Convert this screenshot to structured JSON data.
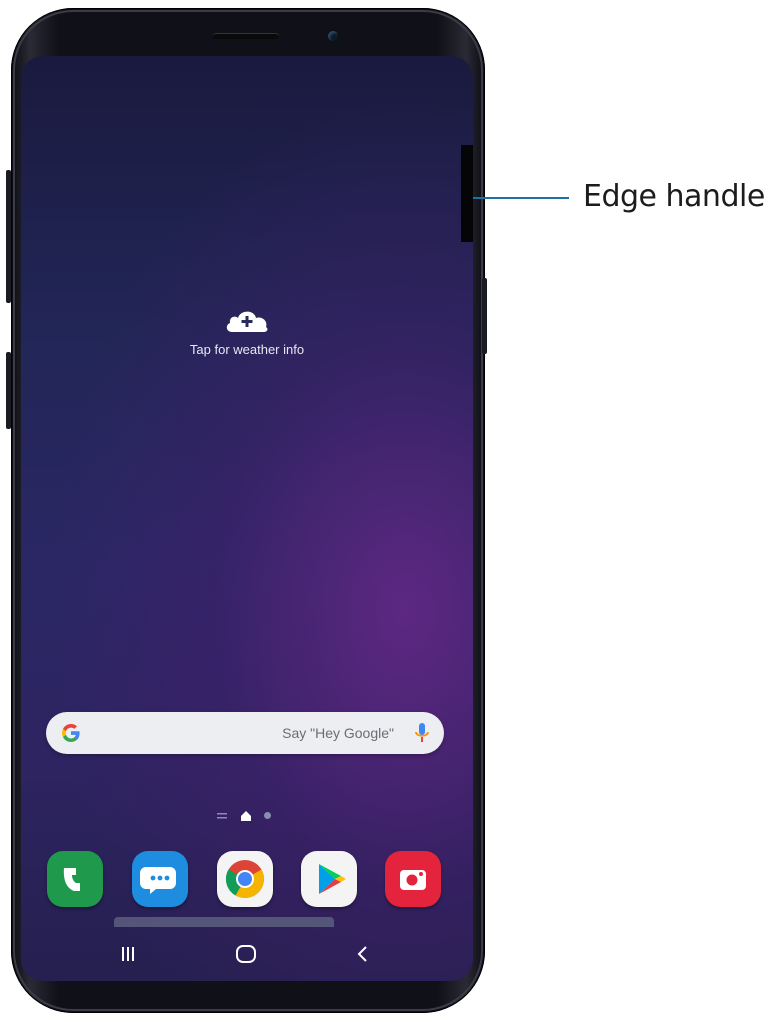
{
  "weather": {
    "label": "Tap for weather info",
    "icon": "cloud-plus-icon"
  },
  "search_bar": {
    "placeholder": "Say \"Hey Google\"",
    "logo": "google-g-icon",
    "mic": "microphone-icon"
  },
  "pager": {
    "pages": [
      "list",
      "home",
      "dot"
    ],
    "active": "home"
  },
  "dock": {
    "apps": [
      {
        "name": "Phone",
        "icon": "phone-icon",
        "color": "#1f9a4c"
      },
      {
        "name": "Messages",
        "icon": "messages-icon",
        "color": "#1e8de0"
      },
      {
        "name": "Chrome",
        "icon": "chrome-icon",
        "color": "#f4f4f4"
      },
      {
        "name": "Play Store",
        "icon": "play-store-icon",
        "color": "#f4f4f4"
      },
      {
        "name": "Camera",
        "icon": "camera-icon",
        "color": "#e3243c"
      }
    ]
  },
  "navbar": {
    "recents": "recents-icon",
    "home": "home-icon",
    "back": "back-icon"
  },
  "callout": {
    "label": "Edge handle",
    "line_color": "#1f6fa8"
  }
}
